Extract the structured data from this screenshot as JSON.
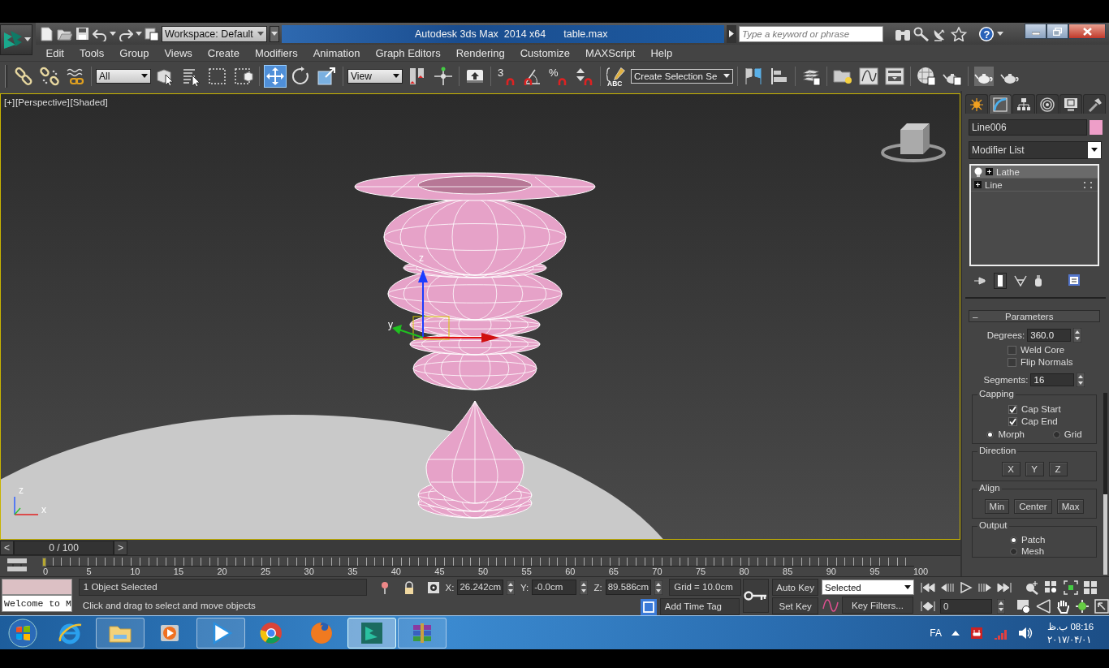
{
  "title_bar": {
    "workspace": "Workspace: Default",
    "app_title": "Autodesk 3ds Max  2014 x64",
    "file_name": "table.max",
    "search_placeholder": "Type a keyword or phrase",
    "help": "?"
  },
  "menu": [
    "Edit",
    "Tools",
    "Group",
    "Views",
    "Create",
    "Modifiers",
    "Animation",
    "Graph Editors",
    "Rendering",
    "Customize",
    "MAXScript",
    "Help"
  ],
  "toolbar": [
    {
      "kind": "link",
      "selected": false
    },
    {
      "kind": "unlink",
      "selected": false
    },
    {
      "kind": "bind",
      "selected": false
    },
    {
      "kind": "dropdown",
      "value": "All"
    },
    {
      "kind": "select",
      "selected": false
    },
    {
      "kind": "select-by-name",
      "selected": false
    },
    {
      "kind": "region",
      "selected": false
    },
    {
      "kind": "crossing",
      "selected": false
    },
    {
      "kind": "move",
      "selected": true
    },
    {
      "kind": "rotate",
      "selected": false
    },
    {
      "kind": "scale",
      "selected": false
    },
    {
      "kind": "dropdown",
      "value": "View"
    },
    {
      "kind": "pivot",
      "selected": false
    },
    {
      "kind": "manipulate",
      "selected": false
    },
    {
      "kind": "shortcut",
      "selected": false
    },
    {
      "kind": "snap",
      "label": "3",
      "selected": false
    },
    {
      "kind": "angle-snap",
      "selected": false
    },
    {
      "kind": "percent-snap",
      "label": "%",
      "selected": false
    },
    {
      "kind": "spinner-snap",
      "selected": false
    },
    {
      "kind": "named-selection",
      "label": "ABC",
      "selected": false
    },
    {
      "kind": "selection-set",
      "value": "Create Selection Se"
    },
    {
      "kind": "mirror",
      "selected": false
    },
    {
      "kind": "align",
      "selected": false
    },
    {
      "kind": "layers",
      "selected": false
    },
    {
      "kind": "explorer",
      "selected": false
    },
    {
      "kind": "curve-editor",
      "selected": false
    },
    {
      "kind": "schematic",
      "selected": false
    },
    {
      "kind": "material",
      "selected": false
    },
    {
      "kind": "render-setup",
      "selected": false
    },
    {
      "kind": "frame-window",
      "selected": false
    },
    {
      "kind": "render",
      "selected": false
    }
  ],
  "viewport": {
    "labels": [
      "[+]",
      "[Perspective]",
      "[Shaded]"
    ],
    "gizmo_axes": [
      "z",
      "y"
    ],
    "tripod_axes": [
      "z",
      "x"
    ]
  },
  "command_panel": {
    "tabs": [
      {
        "kind": "create",
        "selected": false
      },
      {
        "kind": "modify",
        "selected": true
      },
      {
        "kind": "hierarchy",
        "selected": false
      },
      {
        "kind": "motion",
        "selected": false
      },
      {
        "kind": "display",
        "selected": false
      },
      {
        "kind": "utilities",
        "selected": false
      }
    ],
    "object": {
      "name": "Line006",
      "color": "#ee9ec8"
    },
    "modifier_list": "Modifier List",
    "stack": [
      {
        "kind": "modifier",
        "label": "Lathe",
        "selected": true
      },
      {
        "kind": "base",
        "label": "Line",
        "selected": false
      }
    ],
    "rollout": {
      "toggle": "–",
      "title": "Parameters",
      "degrees": {
        "label": "Degrees:",
        "value": "360.0"
      },
      "checks": [
        {
          "label": "Weld Core",
          "checked": false
        },
        {
          "label": "Flip Normals",
          "checked": false
        }
      ],
      "segments": {
        "label": "Segments:",
        "value": "16"
      },
      "capping": {
        "title": "Capping",
        "checks": [
          {
            "label": "Cap Start",
            "checked": true
          },
          {
            "label": "Cap End",
            "checked": true
          }
        ],
        "radios": [
          {
            "label": "Morph",
            "selected": true
          },
          {
            "label": "Grid",
            "selected": false
          }
        ]
      },
      "direction": {
        "title": "Direction",
        "buttons": [
          "X",
          "Y",
          "Z"
        ]
      },
      "align": {
        "title": "Align",
        "buttons": [
          "Min",
          "Center",
          "Max"
        ]
      },
      "output": {
        "title": "Output",
        "radios": [
          {
            "label": "Patch",
            "selected": true
          },
          {
            "label": "Mesh",
            "selected": false
          }
        ]
      }
    }
  },
  "time_slider": {
    "prev": "<",
    "next": ">",
    "frame": "0 / 100",
    "level": 0
  },
  "track_labels": [
    "0",
    "5",
    "10",
    "15",
    "20",
    "25",
    "30",
    "35",
    "40",
    "45",
    "50",
    "55",
    "60",
    "65",
    "70",
    "75",
    "80",
    "85",
    "90",
    "95",
    "100"
  ],
  "status": {
    "listener": "Welcome to M",
    "selection": "1 Object Selected",
    "prompt": "Click and drag to select and move objects",
    "coords": [
      {
        "label": "X:",
        "value": "26.242cm"
      },
      {
        "label": "Y:",
        "value": "-0.0cm"
      },
      {
        "label": "Z:",
        "value": "89.586cm"
      }
    ],
    "grid": "Grid = 10.0cm",
    "time_tag": "Add Time Tag",
    "auto_key": "Auto Key",
    "set_key": "Set Key",
    "key_mode": "Selected",
    "key_filters": "Key Filters...",
    "frame": "0"
  },
  "taskbar": {
    "apps": [
      {
        "kind": "ie",
        "running": false,
        "selected": false
      },
      {
        "kind": "explorer",
        "running": true,
        "selected": false
      },
      {
        "kind": "media",
        "running": false,
        "selected": false
      },
      {
        "kind": "player",
        "running": true,
        "selected": false
      },
      {
        "kind": "chrome",
        "running": false,
        "selected": false
      },
      {
        "kind": "firefox",
        "running": false,
        "selected": false
      },
      {
        "kind": "max",
        "running": true,
        "selected": true
      },
      {
        "kind": "winrar",
        "running": true,
        "selected": false
      }
    ],
    "language": "FA",
    "time": "08:16 ب.ظ",
    "date": "۲۰۱۷/۰۴/۰۱"
  }
}
